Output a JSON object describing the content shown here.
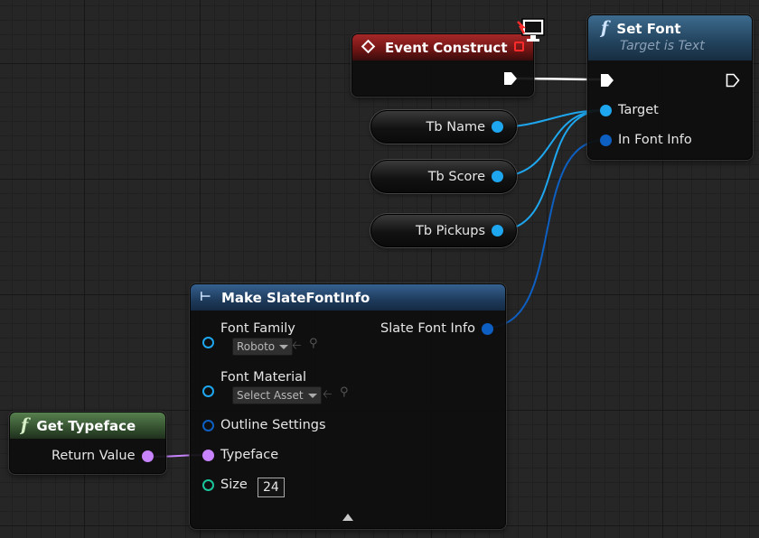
{
  "event_construct": {
    "title": "Event Construct",
    "header_color": "#8e1e1e"
  },
  "set_font": {
    "title": "Set Font",
    "subtitle": "Target is Text",
    "header_color": "#2b4f6a",
    "pins": {
      "target": "Target",
      "in_font_info": "In Font Info"
    }
  },
  "variables": [
    {
      "label": "Tb Name"
    },
    {
      "label": "Tb Score"
    },
    {
      "label": "Tb Pickups"
    }
  ],
  "make_slate_font_info": {
    "title": "Make SlateFontInfo",
    "header_color": "#2a4d73",
    "inputs": {
      "font_family": {
        "label": "Font Family",
        "value": "Roboto"
      },
      "font_material": {
        "label": "Font Material",
        "value": "Select Asset"
      },
      "outline_settings": {
        "label": "Outline Settings"
      },
      "typeface": {
        "label": "Typeface"
      },
      "size": {
        "label": "Size",
        "value": "24"
      }
    },
    "output": {
      "label": "Slate Font Info"
    }
  },
  "get_typeface": {
    "title": "Get Typeface",
    "header_color": "#3a5a38",
    "output": {
      "label": "Return Value"
    }
  },
  "pin_colors": {
    "object": "#1ea6ee",
    "struct": "#0d5fc2",
    "name": "#c884ff",
    "int": "#1bc59b",
    "exec": "#ffffff"
  }
}
